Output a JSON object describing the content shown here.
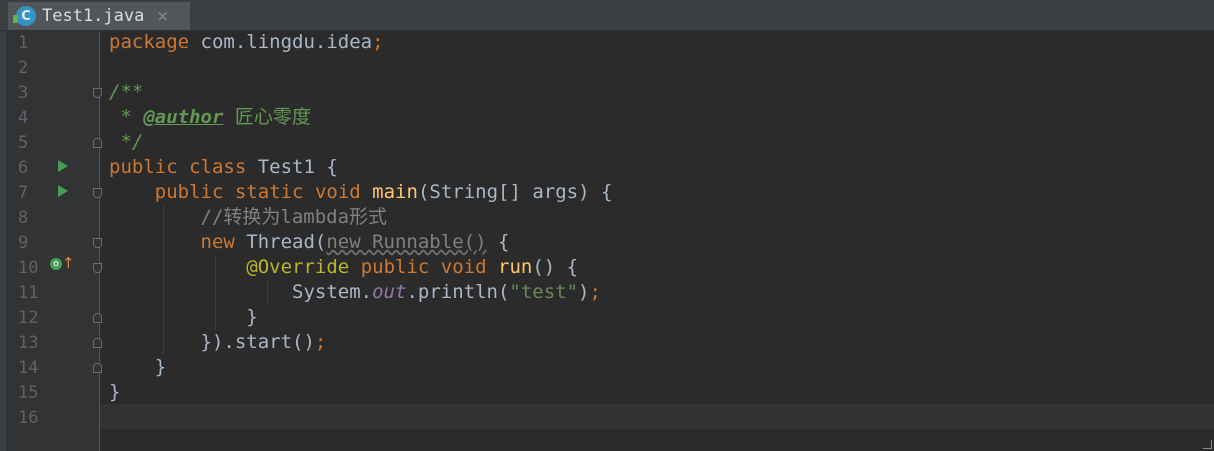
{
  "tab": {
    "icon_letter": "C",
    "filename": "Test1.java",
    "close_glyph": "×"
  },
  "gutter": {
    "line_numbers": [
      "1",
      "2",
      "3",
      "4",
      "5",
      "6",
      "7",
      "8",
      "9",
      "10",
      "11",
      "12",
      "13",
      "14",
      "15",
      "16"
    ],
    "override_glyph": "↑"
  },
  "code": {
    "l1": {
      "kw": "package",
      "rest": " com.lingdu.idea",
      "semi": ";"
    },
    "l3": {
      "open": "/**"
    },
    "l4": {
      "star": " * ",
      "tag": "@author",
      "text": " 匠心零度"
    },
    "l5": {
      "close": " */"
    },
    "l6": {
      "kw1": "public",
      "kw2": "class",
      "rest": " Test1 {"
    },
    "l7": {
      "kw1": "public",
      "kw2": "static",
      "kw3": "void",
      "fn": "main",
      "rest": "(String[] args) {"
    },
    "l8": {
      "comment": "//转换为lambda形式"
    },
    "l9": {
      "kw": "new",
      "cls": " Thread(",
      "anon": "new Runnable()",
      "rest": " {"
    },
    "l10": {
      "ann": "@Override",
      "kw1": "public",
      "kw2": "void",
      "fn": "run",
      "rest": "() {"
    },
    "l11": {
      "cls": "System.",
      "fld": "out",
      "call": ".println(",
      "str": "\"test\"",
      "end": ")",
      "semi": ";"
    },
    "l12": {
      "text": "}"
    },
    "l13": {
      "text": "}).start()",
      "semi": ";"
    },
    "l14": {
      "text": "}"
    },
    "l15": {
      "text": "}"
    }
  }
}
